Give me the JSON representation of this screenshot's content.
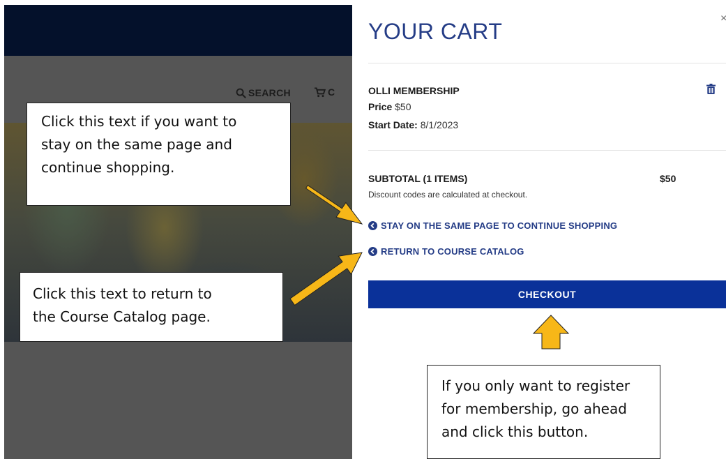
{
  "site": {
    "nav": {
      "search_label": "SEARCH",
      "cart_label": "C"
    }
  },
  "cart": {
    "title": "YOUR CART",
    "close_label": "×",
    "item": {
      "name": "OLLI MEMBERSHIP",
      "price_label": "Price",
      "price_value": "$50",
      "start_date_label": "Start Date:",
      "start_date_value": "8/1/2023"
    },
    "subtotal_label": "SUBTOTAL (1 ITEMS)",
    "subtotal_value": "$50",
    "discount_note": "Discount codes are calculated at checkout.",
    "links": {
      "continue_shopping": "STAY ON THE SAME PAGE TO CONTINUE SHOPPING",
      "return_catalog": "RETURN TO COURSE CATALOG"
    },
    "checkout_label": "CHECKOUT",
    "colors": {
      "title": "#243c86",
      "link": "#243c86",
      "checkout_bg": "#0a3199",
      "header_bg": "#04112b",
      "arrow_fill": "#f7b718"
    }
  },
  "callouts": {
    "continue_shopping": {
      "line1": "Click this text if you want to",
      "line2": "stay on the same page and",
      "line3": "continue shopping."
    },
    "return_catalog": {
      "line1": "Click this text to return to",
      "line2": "the Course Catalog page."
    },
    "checkout": {
      "line1": "If you only want to register",
      "line2": "for membership, go ahead",
      "line3": "and click this button."
    }
  }
}
